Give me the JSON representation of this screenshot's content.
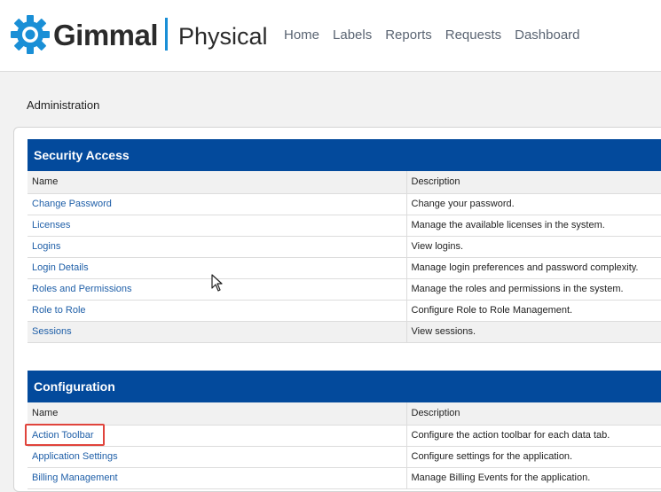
{
  "app": {
    "logo_word": "Gimmal",
    "product": "Physical",
    "nav": [
      "Home",
      "Labels",
      "Reports",
      "Requests",
      "Dashboard"
    ]
  },
  "page": {
    "title": "Administration"
  },
  "colors": {
    "header_blue": "#034a9c",
    "link": "#1f5fa8",
    "highlight": "#e0443c",
    "accent": "#1a8fd6"
  },
  "security_access": {
    "title": "Security Access",
    "col_name": "Name",
    "col_desc": "Description",
    "rows": [
      {
        "name": "Change Password",
        "desc": "Change your password."
      },
      {
        "name": "Licenses",
        "desc": "Manage the available licenses in the system."
      },
      {
        "name": "Logins",
        "desc": "View logins."
      },
      {
        "name": "Login Details",
        "desc": "Manage login preferences and password complexity."
      },
      {
        "name": "Roles and Permissions",
        "desc": "Manage the roles and permissions in the system."
      },
      {
        "name": "Role to Role",
        "desc": "Configure Role to Role Management."
      },
      {
        "name": "Sessions",
        "desc": "View sessions."
      }
    ]
  },
  "configuration": {
    "title": "Configuration",
    "col_name": "Name",
    "col_desc": "Description",
    "rows": [
      {
        "name": "Action Toolbar",
        "desc": "Configure the action toolbar for each data tab."
      },
      {
        "name": "Application Settings",
        "desc": "Configure settings for the application."
      },
      {
        "name": "Billing Management",
        "desc": "Manage Billing Events for the application."
      }
    ]
  }
}
